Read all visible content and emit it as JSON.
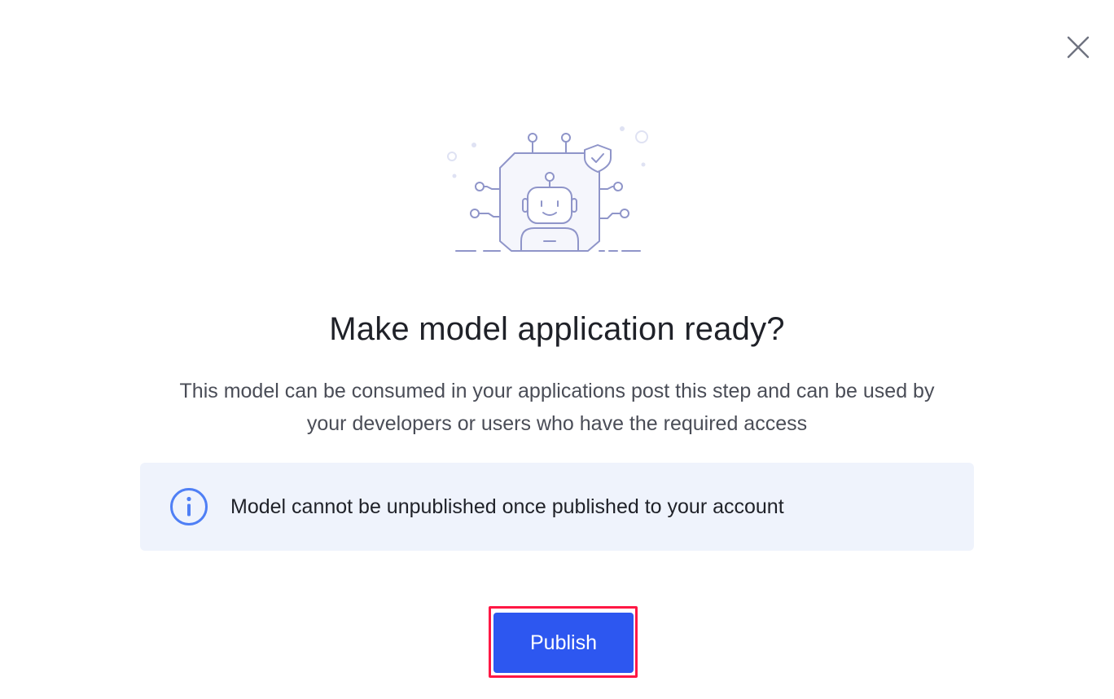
{
  "dialog": {
    "close_icon": "close-icon",
    "illustration": "robot-shield-illustration",
    "title": "Make model application ready?",
    "description": "This model can be consumed in your applications post this step and can be used by your developers or users who have the required access",
    "info": {
      "icon": "info-icon",
      "text": "Model cannot be unpublished once published to your account"
    },
    "publish_label": "Publish"
  },
  "colors": {
    "primary_button": "#2d57f0",
    "highlight_border": "#ff1744",
    "info_background": "#eff3fc",
    "info_icon": "#4f7ff5",
    "illustration_stroke": "#8f95c9"
  }
}
